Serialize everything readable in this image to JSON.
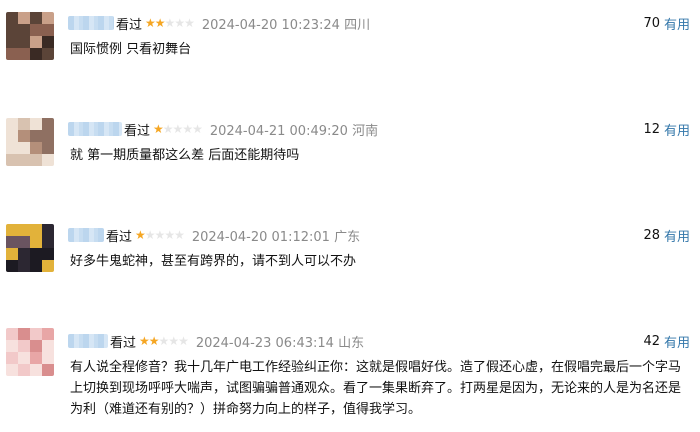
{
  "ui": {
    "watched_label": "看过",
    "useful_label": "有用"
  },
  "comments": [
    {
      "stars": "★★☆☆☆",
      "time": "2024-04-20 10:23:24",
      "region": "四川",
      "votes": "70",
      "text": "国际惯例 只看初舞台",
      "avatar_colors": [
        "#3a2a24",
        "#8a6050",
        "#c9a089",
        "#5b4438"
      ]
    },
    {
      "stars": "★☆☆☆☆",
      "time": "2024-04-21 00:49:20",
      "region": "河南",
      "votes": "12",
      "text": "就 第一期质量都这么差 后面还能期待吗",
      "avatar_colors": [
        "#d8c2b0",
        "#b48f7a",
        "#efe2d6",
        "#8f7062"
      ]
    },
    {
      "stars": "★☆☆☆☆",
      "time": "2024-04-20 01:12:01",
      "region": "广东",
      "votes": "28",
      "text": "好多牛鬼蛇神，甚至有跨界的，请不到人可以不办",
      "avatar_colors": [
        "#2c2732",
        "#e2b23a",
        "#6a5460",
        "#1c1a22"
      ]
    },
    {
      "stars": "★★☆☆☆",
      "time": "2024-04-23 06:43:14",
      "region": "山东",
      "votes": "42",
      "text": "有人说全程修音？我十几年广电工作经验纠正你：这就是假唱好伐。造了假还心虚，在假唱完最后一个字马上切换到现场呼呼大喘声，试图骗骗普通观众。看了一集果断弃了。打两星是因为，无论来的人是为名还是为利（难道还有别的？）拼命努力向上的样子，值得我学习。",
      "avatar_colors": [
        "#f2c9c9",
        "#e8a6a6",
        "#f7e1de",
        "#d98e8e"
      ]
    }
  ]
}
